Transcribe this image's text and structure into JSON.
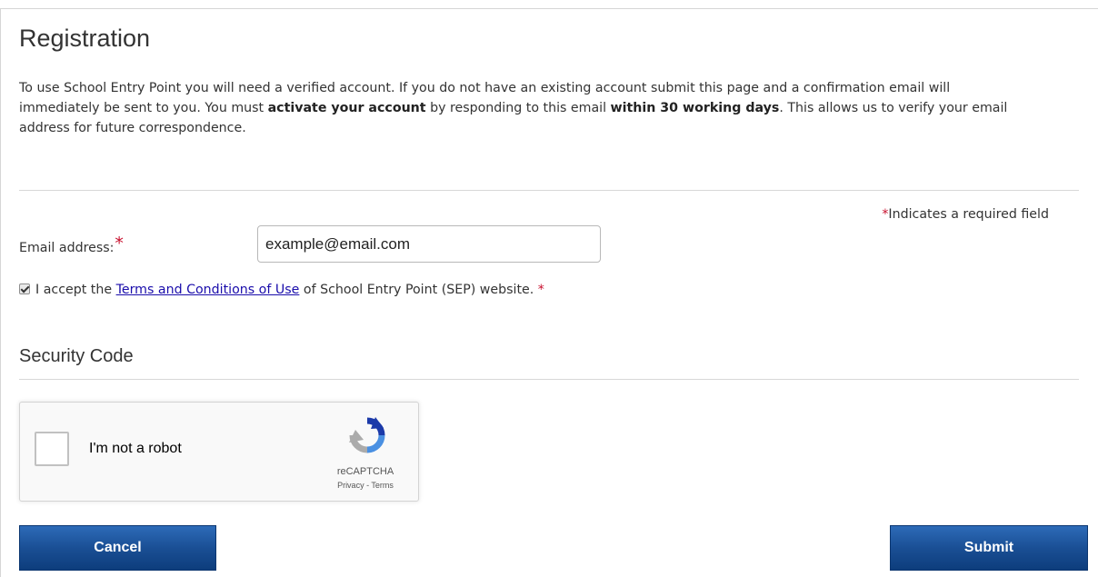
{
  "page": {
    "title": "Registration",
    "intro": {
      "p1": "To use School Entry Point you will need a verified account. If you do not have an existing account submit this page and a confirmation email will immediately be sent to you. You must ",
      "b1": "activate your account",
      "p2": " by responding to this email ",
      "b2": "within 30 working days",
      "p3": ". This allows us to verify your email address for future correspondence."
    },
    "required_star": "*",
    "required_note": "Indicates a required field"
  },
  "form": {
    "email_label": "Email address:",
    "email_value": "example@email.com",
    "terms": {
      "checked": true,
      "prefix": "I accept the ",
      "link": "Terms and Conditions of Use",
      "suffix": " of School Entry Point (SEP) website. "
    }
  },
  "security": {
    "title": "Security Code",
    "captcha": {
      "label": "I'm not a robot",
      "brand": "reCAPTCHA",
      "privacy": "Privacy",
      "sep": " - ",
      "terms": "Terms",
      "icon": "recaptcha-logo"
    }
  },
  "buttons": {
    "cancel": "Cancel",
    "submit": "Submit",
    "color": "#1a4f95"
  },
  "colors": {
    "required": "#c8102e",
    "link": "#1a0dab"
  }
}
